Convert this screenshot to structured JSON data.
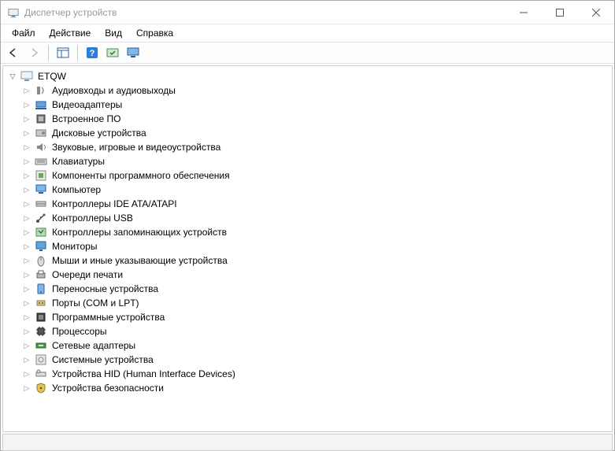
{
  "window": {
    "title": "Диспетчер устройств"
  },
  "menu": {
    "file": "Файл",
    "action": "Действие",
    "view": "Вид",
    "help": "Справка"
  },
  "tree": {
    "root": {
      "label": "ETQW"
    },
    "categories": [
      {
        "icon": "audio-io",
        "label": "Аудиовходы и аудиовыходы"
      },
      {
        "icon": "display-adapter",
        "label": "Видеоадаптеры"
      },
      {
        "icon": "firmware",
        "label": "Встроенное ПО"
      },
      {
        "icon": "disk",
        "label": "Дисковые устройства"
      },
      {
        "icon": "sound",
        "label": "Звуковые, игровые и видеоустройства"
      },
      {
        "icon": "keyboard",
        "label": "Клавиатуры"
      },
      {
        "icon": "software-comp",
        "label": "Компоненты программного обеспечения"
      },
      {
        "icon": "computer",
        "label": "Компьютер"
      },
      {
        "icon": "ide",
        "label": "Контроллеры IDE ATA/ATAPI"
      },
      {
        "icon": "usb",
        "label": "Контроллеры USB"
      },
      {
        "icon": "storage-ctrl",
        "label": "Контроллеры запоминающих устройств"
      },
      {
        "icon": "monitor",
        "label": "Мониторы"
      },
      {
        "icon": "mouse",
        "label": "Мыши и иные указывающие устройства"
      },
      {
        "icon": "print-queue",
        "label": "Очереди печати"
      },
      {
        "icon": "portable",
        "label": "Переносные устройства"
      },
      {
        "icon": "ports",
        "label": "Порты (COM и LPT)"
      },
      {
        "icon": "software-dev",
        "label": "Программные устройства"
      },
      {
        "icon": "cpu",
        "label": "Процессоры"
      },
      {
        "icon": "network",
        "label": "Сетевые адаптеры"
      },
      {
        "icon": "system",
        "label": "Системные устройства"
      },
      {
        "icon": "hid",
        "label": "Устройства HID (Human Interface Devices)"
      },
      {
        "icon": "security",
        "label": "Устройства безопасности"
      }
    ]
  }
}
